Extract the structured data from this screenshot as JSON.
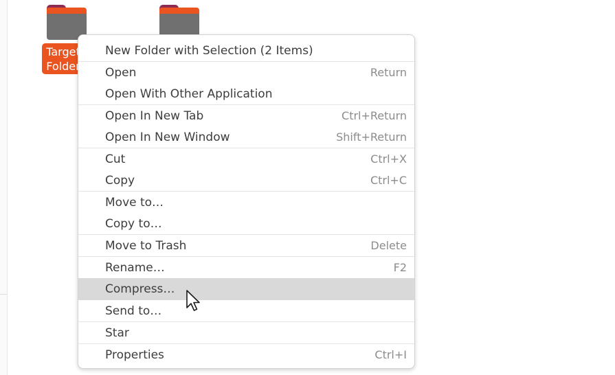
{
  "desktop": {
    "folders": [
      {
        "label_line1": "Target",
        "label_line2": "Folder",
        "selected": true
      },
      {
        "selected": true
      }
    ],
    "accent_color": "#e95420"
  },
  "context_menu": {
    "items": [
      {
        "label": "New Folder with Selection (2 Items)",
        "shortcut": ""
      },
      {
        "label": "Open",
        "shortcut": "Return"
      },
      {
        "label": "Open With Other Application",
        "shortcut": ""
      },
      {
        "label": "Open In New Tab",
        "shortcut": "Ctrl+Return"
      },
      {
        "label": "Open In New Window",
        "shortcut": "Shift+Return"
      },
      {
        "label": "Cut",
        "shortcut": "Ctrl+X"
      },
      {
        "label": "Copy",
        "shortcut": "Ctrl+C"
      },
      {
        "label": "Move to…",
        "shortcut": ""
      },
      {
        "label": "Copy to…",
        "shortcut": ""
      },
      {
        "label": "Move to Trash",
        "shortcut": "Delete"
      },
      {
        "label": "Rename…",
        "shortcut": "F2"
      },
      {
        "label": "Compress…",
        "shortcut": "",
        "hovered": true
      },
      {
        "label": "Send to…",
        "shortcut": ""
      },
      {
        "label": "Star",
        "shortcut": ""
      },
      {
        "label": "Properties",
        "shortcut": "Ctrl+I"
      }
    ],
    "hover_color": "#d9d9d9"
  },
  "cursor": {
    "icon": "arrow-pointer-icon"
  }
}
